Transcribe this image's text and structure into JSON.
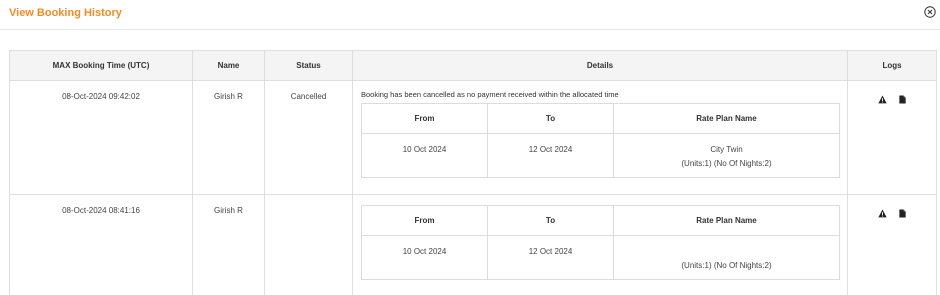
{
  "modal": {
    "title": "View Booking History",
    "close_icon": "close-circle-icon"
  },
  "table": {
    "headers": {
      "booking_time": "MAX Booking Time (UTC)",
      "name": "Name",
      "status": "Status",
      "details": "Details",
      "logs": "Logs"
    },
    "rows": [
      {
        "booking_time": "08-Oct-2024 09:42:02",
        "name": "Girish R",
        "status": "Cancelled",
        "message": "Booking has been cancelled as no payment received within the allocated time",
        "inner_headers": {
          "from": "From",
          "to": "To",
          "rate_plan": "Rate Plan Name"
        },
        "from": "10 Oct 2024",
        "to": "12 Oct 2024",
        "rate_plan_name": "City Twin",
        "rate_plan_detail": "(Units:1) (No Of Nights:2)",
        "log_icons": [
          "warning-icon",
          "document-icon"
        ]
      },
      {
        "booking_time": "08-Oct-2024 08:41:16",
        "name": "Girish R",
        "status": "",
        "message": "",
        "inner_headers": {
          "from": "From",
          "to": "To",
          "rate_plan": "Rate Plan Name"
        },
        "from": "10 Oct 2024",
        "to": "12 Oct 2024",
        "rate_plan_name": "",
        "rate_plan_detail": "(Units:1) (No Of Nights:2)",
        "log_icons": [
          "warning-icon",
          "document-icon"
        ]
      }
    ]
  }
}
